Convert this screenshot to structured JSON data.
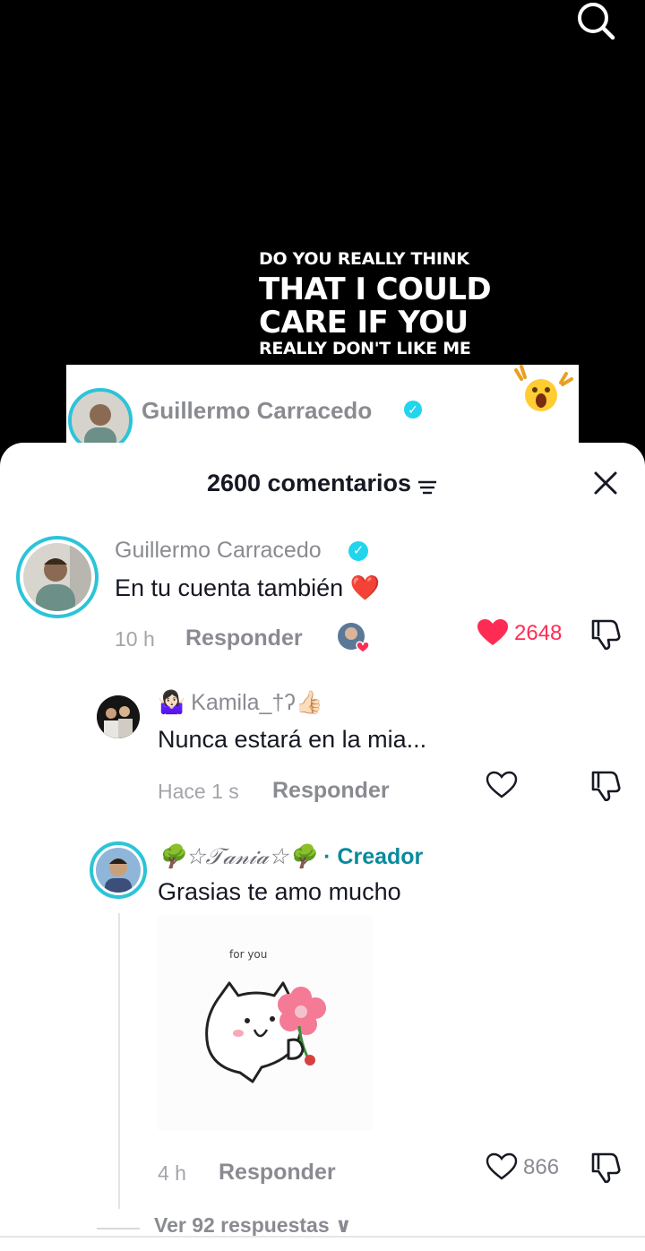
{
  "video": {
    "overlay_lines": [
      "DO YOU REALLY THINK",
      "THAT I COULD",
      "CARE IF YOU",
      "REALLY DON'T LIKE ME"
    ],
    "embedded_card": {
      "username": "Guillermo Carracedo"
    },
    "search_icon": "search-icon"
  },
  "sheet": {
    "title": "2600 comentarios",
    "sort_icon": "sort-icon",
    "close_icon": "close-icon"
  },
  "comments": [
    {
      "username": "Guillermo Carracedo",
      "verified": true,
      "text": "En tu cuenta también ❤️",
      "time": "10 h",
      "reply_label": "Responder",
      "likes": "2648",
      "liked": true
    },
    {
      "username_prefix": "🤷🏻‍♀️",
      "username": "Kamila_†ʔ👍🏻",
      "text": "Nunca estará en la mia...",
      "time": "Hace 1 s",
      "reply_label": "Responder"
    },
    {
      "username": "🌳☆𝒯𝒶𝓃𝒾𝒶☆🌳",
      "creator_label": "· Creador",
      "text": "Grasias te amo mucho",
      "sticker_caption": "for you",
      "time": "4 h",
      "reply_label": "Responder",
      "likes": "866"
    }
  ],
  "view_replies": "Ver 92 respuestas ∨",
  "colors": {
    "accent_red": "#fe2c55",
    "creator_teal": "#0a8a9c",
    "verified_blue": "#20d5ec",
    "ring": "#2bc4d8"
  }
}
